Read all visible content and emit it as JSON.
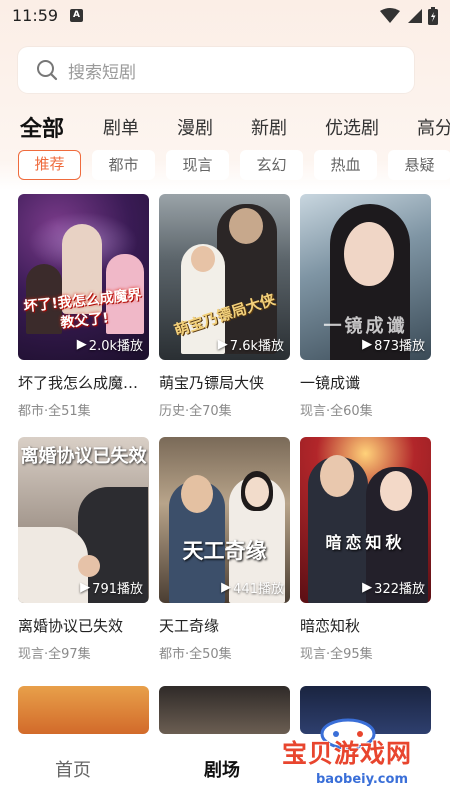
{
  "status_bar": {
    "time": "11:59",
    "notif_letter": "A"
  },
  "search": {
    "placeholder": "搜索短剧"
  },
  "main_tabs": [
    {
      "label": "全部",
      "active": true
    },
    {
      "label": "剧单"
    },
    {
      "label": "漫剧"
    },
    {
      "label": "新剧"
    },
    {
      "label": "优选剧"
    },
    {
      "label": "高分"
    }
  ],
  "sub_tabs": [
    {
      "label": "推荐",
      "active": true
    },
    {
      "label": "都市"
    },
    {
      "label": "现言"
    },
    {
      "label": "玄幻"
    },
    {
      "label": "热血"
    },
    {
      "label": "悬疑"
    }
  ],
  "cards": [
    {
      "title": "坏了我怎么成魔…",
      "meta": "都市·全51集",
      "plays": "2.0k播放",
      "art": "坏了!我怎么成魔界教父了!"
    },
    {
      "title": "萌宝乃镖局大侠",
      "meta": "历史·全70集",
      "plays": "7.6k播放",
      "art": "萌宝乃镖局大侠"
    },
    {
      "title": "一镜成谶",
      "meta": "现言·全60集",
      "plays": "873播放",
      "art": "一镜成谶"
    },
    {
      "title": "离婚协议已失效",
      "meta": "现言·全97集",
      "plays": "791播放",
      "art": "离婚协议已失效"
    },
    {
      "title": "天工奇缘",
      "meta": "都市·全50集",
      "plays": "441播放",
      "art": "天工奇缘"
    },
    {
      "title": "暗恋知秋",
      "meta": "现言·全95集",
      "plays": "322播放",
      "art": "暗恋知秋"
    }
  ],
  "bottom_nav": [
    {
      "label": "首页"
    },
    {
      "label": "剧场",
      "active": true
    }
  ],
  "watermark": {
    "text": "宝贝游戏网",
    "url": "baobeiy.com"
  },
  "colors": {
    "accent": "#ef6b3d",
    "watermark_red": "#e8452e",
    "watermark_blue": "#3a6fd8"
  }
}
